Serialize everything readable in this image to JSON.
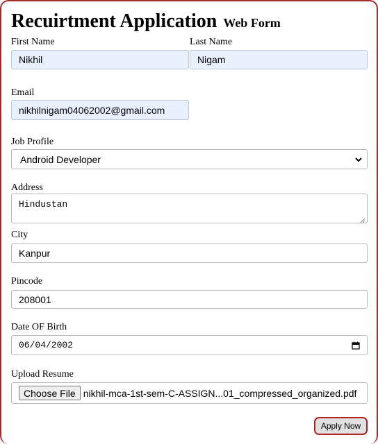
{
  "title": {
    "main": "Recuirtment Application",
    "sub": "Web Form"
  },
  "fields": {
    "first_name": {
      "label": "First Name",
      "value": "Nikhil"
    },
    "last_name": {
      "label": "Last Name",
      "value": "Nigam"
    },
    "email": {
      "label": "Email",
      "value": "nikhilnigam04062002@gmail.com"
    },
    "job_profile": {
      "label": "Job Profile",
      "value": "Android Developer"
    },
    "address": {
      "label": "Address",
      "value": "Hindustan"
    },
    "city": {
      "label": "City",
      "value": "Kanpur"
    },
    "pincode": {
      "label": "Pincode",
      "value": "208001"
    },
    "dob": {
      "label": "Date OF Birth",
      "value": "06/04/2002"
    },
    "resume": {
      "label": "Upload Resume",
      "button": "Choose File",
      "filename": "nikhil-mca-1st-sem-C-ASSIGN...01_compressed_organized.pdf"
    }
  },
  "submit": {
    "label": "Apply Now"
  },
  "colors": {
    "frame": "#a52a2a",
    "autofill": "#e8f0fe",
    "button_border": "#b22222"
  },
  "icons": {
    "select": "chevron-down-icon",
    "date": "calendar-icon",
    "textarea": "resize-grip-icon"
  }
}
